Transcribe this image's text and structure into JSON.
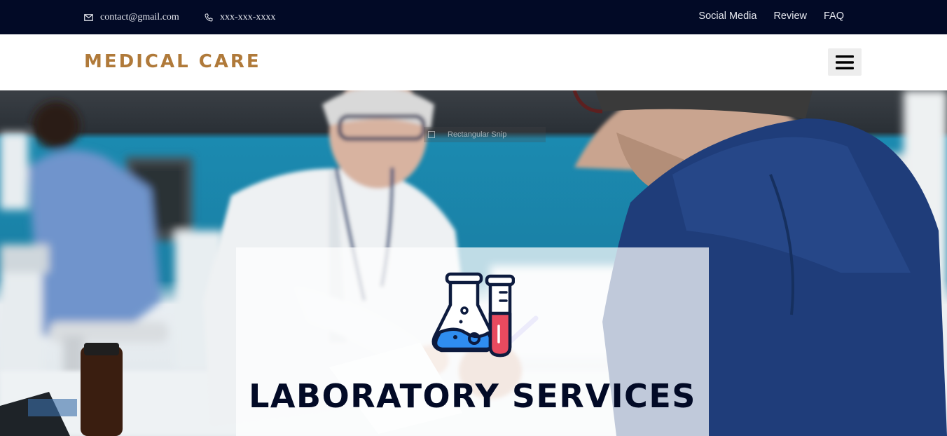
{
  "topbar": {
    "email": "contact@gmail.com",
    "phone": "xxx-xxx-xxxx",
    "links": [
      "Social Media",
      "Review",
      "FAQ"
    ]
  },
  "navbar": {
    "brand": "MEDICAL CARE",
    "menu_icon": "hamburger-icon"
  },
  "hero": {
    "background": "photo: doctor consulting with patient at desk",
    "overlay_text": "Rectangular Snip",
    "card": {
      "icon": "laboratory-flask-test-tube-icon",
      "title": "LABORATORY SERVICES"
    }
  },
  "colors": {
    "topbar_bg": "#020a26",
    "brand": "#b07a3a",
    "title": "#020a26",
    "flask_liquid": "#2f8df0",
    "tube_liquid": "#e84a5f"
  }
}
